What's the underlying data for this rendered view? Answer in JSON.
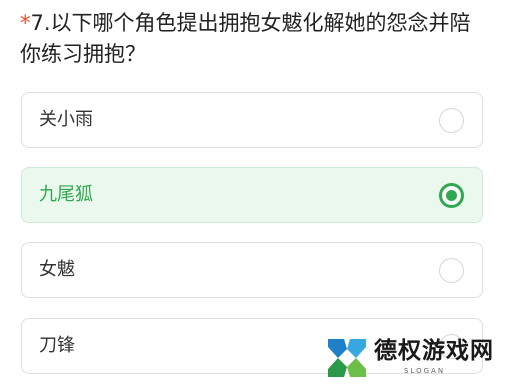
{
  "question": {
    "required_mark": "*",
    "text": "7.以下哪个角色提出拥抱女魃化解她的怨念并陪你练习拥抱？"
  },
  "options": [
    {
      "label": "关小雨",
      "selected": false
    },
    {
      "label": "九尾狐",
      "selected": true
    },
    {
      "label": "女魃",
      "selected": false
    },
    {
      "label": "刀锋",
      "selected": false
    }
  ],
  "watermark": {
    "name": "德权游戏网",
    "slogan": "SLOGAN"
  },
  "colors": {
    "accent": "#2fa84f",
    "required": "#e8502f",
    "selected_bg": "#ebf8ee"
  }
}
